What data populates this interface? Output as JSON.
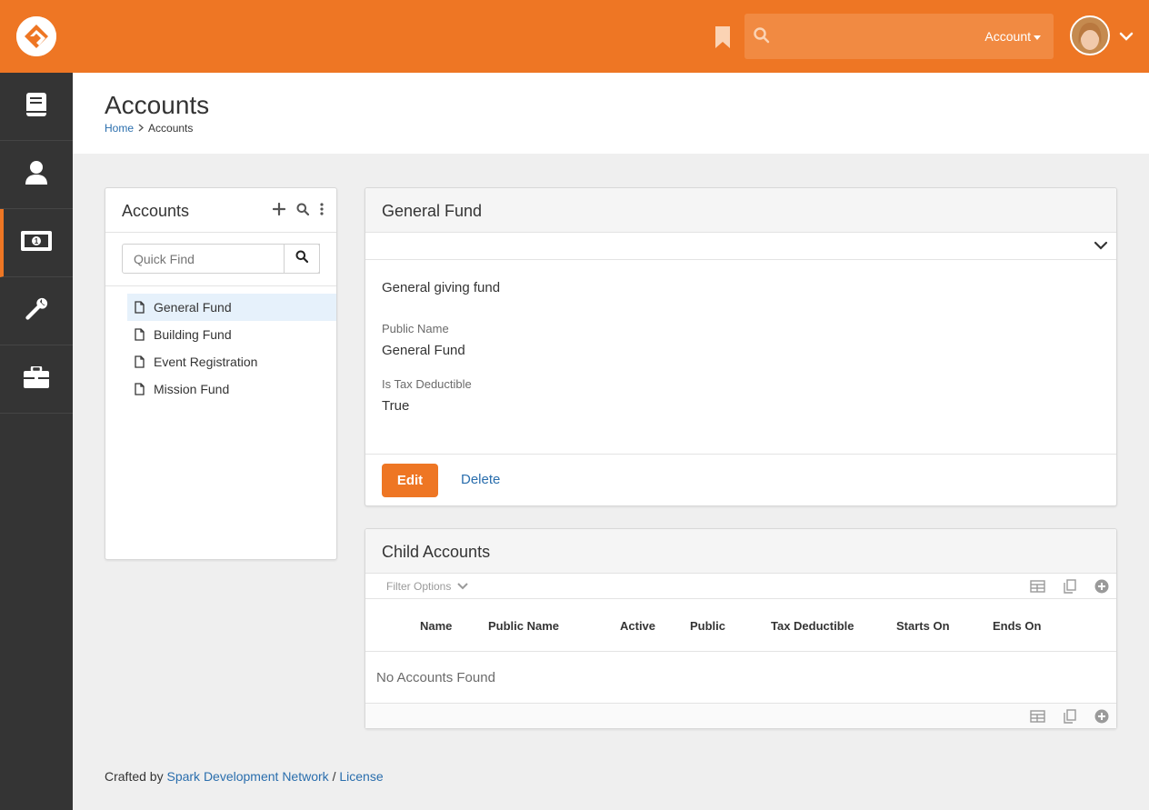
{
  "topbar": {
    "search": {
      "account_label": "Account"
    },
    "colors": {
      "brand": "#ee7624",
      "sidebar": "#343434",
      "link": "#2a6ead"
    }
  },
  "sidebar": {
    "items": [
      {
        "icon": "book-icon"
      },
      {
        "icon": "person-icon"
      },
      {
        "icon": "money-icon",
        "active": true
      },
      {
        "icon": "wrench-icon"
      },
      {
        "icon": "briefcase-icon"
      }
    ]
  },
  "page": {
    "title": "Accounts",
    "breadcrumb": {
      "home": "Home",
      "current": "Accounts"
    }
  },
  "tree": {
    "title": "Accounts",
    "quickfind_placeholder": "Quick Find",
    "items": [
      "General Fund",
      "Building Fund",
      "Event Registration",
      "Mission Fund"
    ],
    "selected_index": 0
  },
  "detail": {
    "title": "General Fund",
    "description": "General giving fund",
    "public_name_label": "Public Name",
    "public_name_value": "General Fund",
    "tax_label": "Is Tax Deductible",
    "tax_value": "True",
    "edit_label": "Edit",
    "delete_label": "Delete"
  },
  "child_accounts": {
    "title": "Child Accounts",
    "filter_label": "Filter Options",
    "columns": [
      "Name",
      "Public Name",
      "Active",
      "Public",
      "Tax Deductible",
      "Starts On",
      "Ends On"
    ],
    "empty_text": "No Accounts Found"
  },
  "footer": {
    "prefix": "Crafted by",
    "org_link": "Spark Development Network",
    "separator": "/",
    "license_link": "License"
  }
}
